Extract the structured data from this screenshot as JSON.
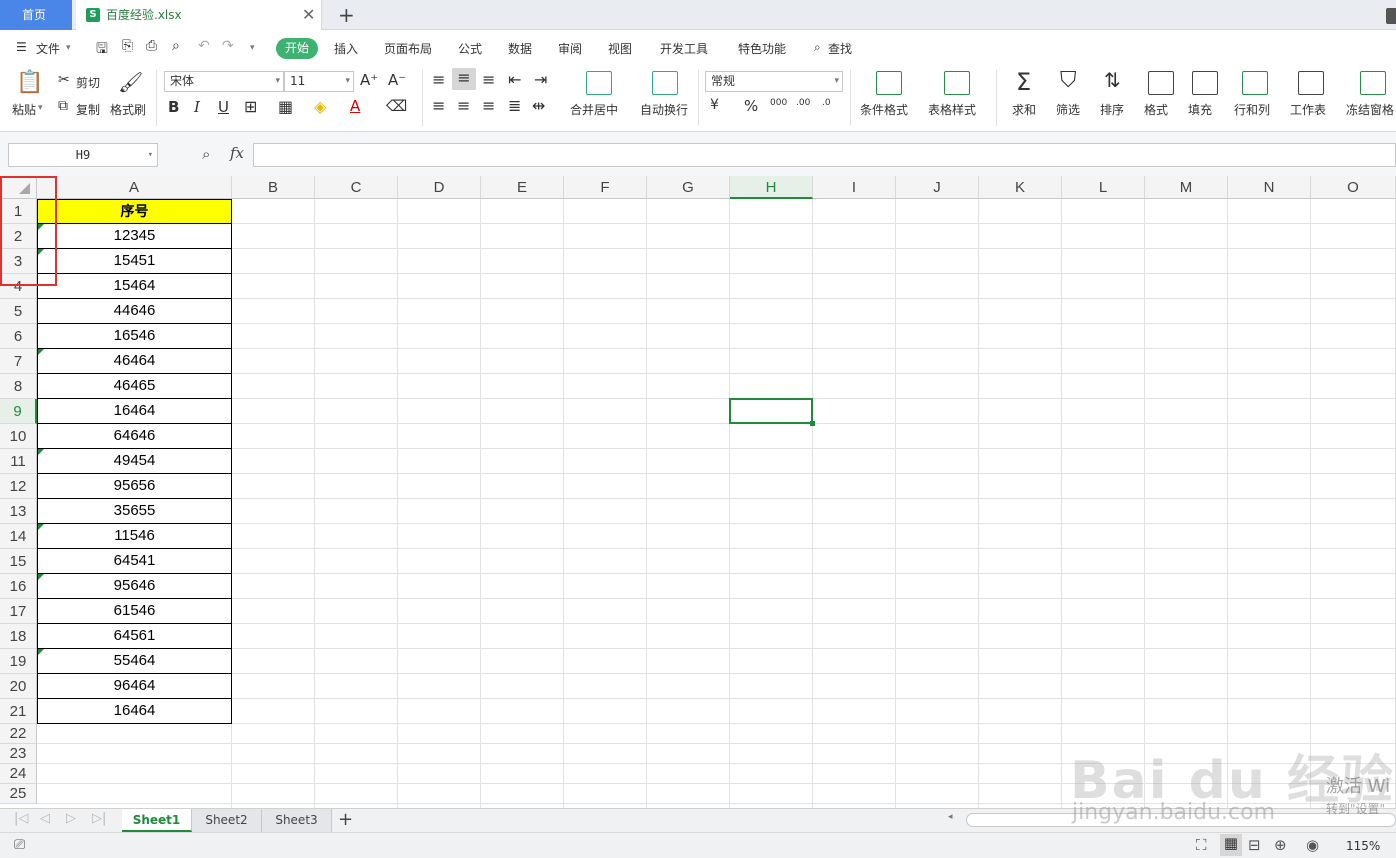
{
  "tabs": {
    "home": "首页",
    "file_name": "百度经验.xlsx"
  },
  "menu": [
    "文件",
    "开始",
    "插入",
    "页面布局",
    "公式",
    "数据",
    "审阅",
    "视图",
    "开发工具",
    "特色功能",
    "查找"
  ],
  "ribbon": {
    "paste": "粘贴",
    "cut": "剪切",
    "copy": "复制",
    "format_painter": "格式刷",
    "font_name": "宋体",
    "font_size": "11",
    "merge_center": "合并居中",
    "wrap_text": "自动换行",
    "number_format": "常规",
    "conditional_format": "条件格式",
    "table_style": "表格样式",
    "sum": "求和",
    "filter": "筛选",
    "sort": "排序",
    "format": "格式",
    "fill": "填充",
    "row_col": "行和列",
    "worksheet": "工作表",
    "freeze": "冻结窗格"
  },
  "formula_bar": {
    "name_box": "H9",
    "fx": "fx",
    "formula": ""
  },
  "columns": [
    "A",
    "B",
    "C",
    "D",
    "E",
    "F",
    "G",
    "H",
    "I",
    "J",
    "K",
    "L",
    "M",
    "N",
    "O"
  ],
  "active_column": "H",
  "active_row": 9,
  "rows": [
    "1",
    "2",
    "3",
    "4",
    "5",
    "6",
    "7",
    "8",
    "9",
    "10",
    "11",
    "12",
    "13",
    "14",
    "15",
    "16",
    "17",
    "18",
    "19",
    "20",
    "21",
    "22",
    "23",
    "24",
    "25"
  ],
  "column_a": {
    "header": "序号",
    "values": [
      "12345",
      "15451",
      "15464",
      "44646",
      "16546",
      "46464",
      "46465",
      "16464",
      "64646",
      "49454",
      "95656",
      "35655",
      "11546",
      "64541",
      "95646",
      "61546",
      "64561",
      "55464",
      "96464",
      "16464"
    ],
    "text_marked_rows": [
      2,
      3,
      7,
      11,
      14,
      16,
      19
    ]
  },
  "sheets": [
    "Sheet1",
    "Sheet2",
    "Sheet3"
  ],
  "active_sheet": "Sheet1",
  "status": {
    "zoom": "115%"
  },
  "watermark": {
    "brand": "Bai du 经验",
    "url": "jingyan.baidu.com",
    "activate": "激活 Wi",
    "activate_sub": "转到\"设置\""
  },
  "colors": {
    "accent_green": "#1f8b3b",
    "header_fill": "#ffff00",
    "highlight_red": "#e03131",
    "home_tab": "#4a86e8"
  }
}
